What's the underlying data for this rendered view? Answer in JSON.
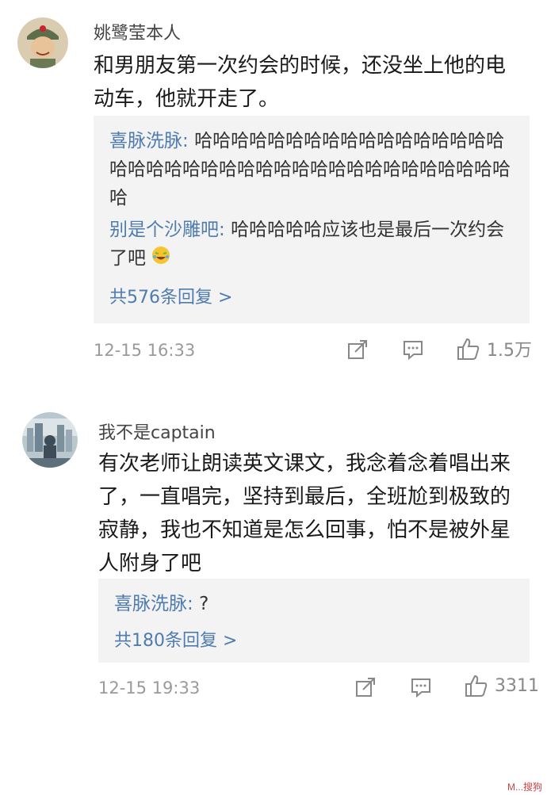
{
  "comments": [
    {
      "username": "姚鹭莹本人",
      "content": "和男朋友第一次约会的时候，还没坐上他的电动车，他就开走了。",
      "replies": [
        {
          "name": "喜脉洗脉:",
          "text": "哈哈哈哈哈哈哈哈哈哈哈哈哈哈哈哈哈哈哈哈哈哈哈哈哈哈哈哈哈哈哈哈哈哈哈哈哈哈哈哈"
        },
        {
          "name": "别是个沙雕吧:",
          "text": "哈哈哈哈哈应该也是最后一次约会了吧",
          "emoji": "laughing-crying-emoji"
        }
      ],
      "more_replies": "共576条回复 >",
      "timestamp": "12-15 16:33",
      "likes": "1.5万"
    },
    {
      "username": "我不是captain",
      "content": "有次老师让朗读英文课文，我念着念着唱出来了，一直唱完，坚持到最后，全班尬到极致的寂静，我也不知道是怎么回事，怕不是被外星人附身了吧",
      "replies": [
        {
          "name": "喜脉洗脉:",
          "text": "?"
        }
      ],
      "more_replies": "共180条回复 >",
      "timestamp": "12-15 19:33",
      "likes": "3311"
    }
  ],
  "icons": {
    "share": "share-icon",
    "comment": "comment-icon",
    "like": "thumbs-up-icon"
  },
  "watermark": "M...搜狗"
}
